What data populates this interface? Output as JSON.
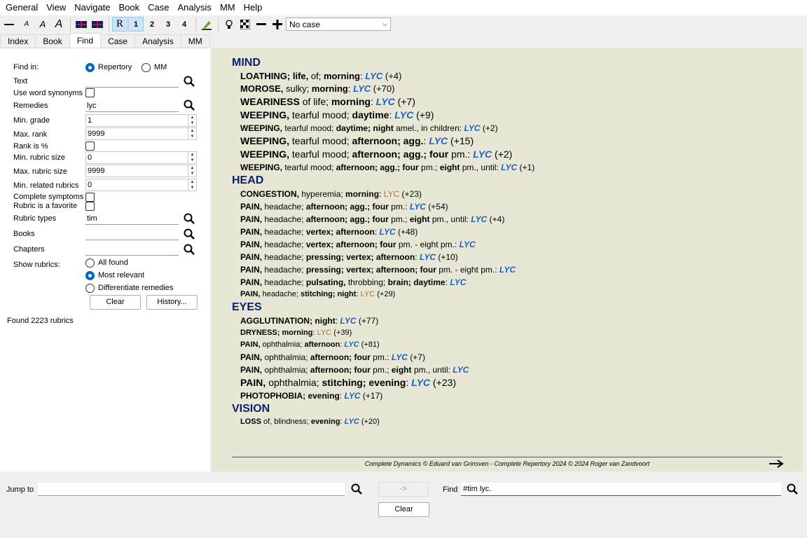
{
  "menu": [
    "General",
    "View",
    "Navigate",
    "Book",
    "Case",
    "Analysis",
    "MM",
    "Help"
  ],
  "toolbar": {
    "r": "R",
    "n1": "1",
    "n2": "2",
    "n3": "3",
    "n4": "4",
    "case_select": "No case"
  },
  "tabs": [
    "Index",
    "Book",
    "Find",
    "Case",
    "Analysis",
    "MM"
  ],
  "find": {
    "find_in_label": "Find in:",
    "repertory": "Repertory",
    "mm": "MM",
    "text_label": "Text",
    "text_value": "",
    "synonyms_label": "Use word synonyms",
    "remedies_label": "Remedies",
    "remedies_value": "lyc",
    "min_grade_label": "Min. grade",
    "min_grade": "1",
    "max_rank_label": "Max. rank",
    "max_rank": "9999",
    "rank_pct_label": "Rank is %",
    "min_rubric_label": "Min. rubric size",
    "min_rubric": "0",
    "max_rubric_label": "Max. rubric size",
    "max_rubric": "9999",
    "min_related_label": "Min. related rubrics",
    "min_related": "0",
    "complete_label": "Complete symptoms",
    "favorite_label": "Rubric is a favorite",
    "rubric_types_label": "Rubric types",
    "rubric_types": "tim",
    "books_label": "Books",
    "books": "",
    "chapters_label": "Chapters",
    "chapters": "",
    "show_label": "Show rubrics:",
    "all_found": "All found",
    "most_relevant": "Most relevant",
    "differentiate": "Differentiate remedies",
    "clear": "Clear",
    "history": "History...",
    "found": "Found 2223 rubrics"
  },
  "results": [
    {
      "chapter": "MIND",
      "rubrics": [
        {
          "sz": 13,
          "parts": [
            [
              "b",
              "LOATHING; life, "
            ],
            [
              "n",
              "of; "
            ],
            [
              "b",
              "morning"
            ],
            [
              "n",
              ": "
            ]
          ],
          "rem": "LYC",
          "cnt": "(+4)"
        },
        {
          "sz": 13,
          "parts": [
            [
              "b",
              "MOROSE, "
            ],
            [
              "n",
              "sulky; "
            ],
            [
              "b",
              "morning"
            ],
            [
              "n",
              ": "
            ]
          ],
          "rem": "LYC",
          "cnt": "(+70)"
        },
        {
          "sz": 14,
          "parts": [
            [
              "b",
              "WEARINESS "
            ],
            [
              "n",
              "of life; "
            ],
            [
              "b",
              "morning"
            ],
            [
              "n",
              ": "
            ]
          ],
          "rem": "LYC",
          "cnt": "(+7)"
        },
        {
          "sz": 14,
          "parts": [
            [
              "b",
              "WEEPING, "
            ],
            [
              "n",
              "tearful mood; "
            ],
            [
              "b",
              "daytime"
            ],
            [
              "n",
              ": "
            ]
          ],
          "rem": "LYC",
          "cnt": "(+9)"
        },
        {
          "sz": 12,
          "parts": [
            [
              "b",
              "WEEPING, "
            ],
            [
              "n",
              "tearful mood; "
            ],
            [
              "b",
              "daytime; night "
            ],
            [
              "n",
              "amel., in children: "
            ]
          ],
          "rem": "LYC",
          "cnt": "(+2)"
        },
        {
          "sz": 14,
          "parts": [
            [
              "b",
              "WEEPING, "
            ],
            [
              "n",
              "tearful mood; "
            ],
            [
              "b",
              "afternoon; agg."
            ],
            [
              "n",
              ": "
            ]
          ],
          "rem": "LYC",
          "cnt": "(+15)"
        },
        {
          "sz": 14,
          "parts": [
            [
              "b",
              "WEEPING, "
            ],
            [
              "n",
              "tearful mood; "
            ],
            [
              "b",
              "afternoon; agg.; four "
            ],
            [
              "n",
              "pm.: "
            ]
          ],
          "rem": "LYC",
          "cnt": "(+2)"
        },
        {
          "sz": 12,
          "parts": [
            [
              "b",
              "WEEPING, "
            ],
            [
              "n",
              "tearful mood; "
            ],
            [
              "b",
              "afternoon; agg.; four "
            ],
            [
              "n",
              "pm.; "
            ],
            [
              "b",
              "eight "
            ],
            [
              "n",
              "pm., until: "
            ]
          ],
          "rem": "LYC",
          "cnt": "(+1)"
        }
      ]
    },
    {
      "chapter": "HEAD",
      "rubrics": [
        {
          "sz": 12,
          "parts": [
            [
              "b",
              "CONGESTION, "
            ],
            [
              "n",
              "hyperemia; "
            ],
            [
              "b",
              "morning"
            ],
            [
              "n",
              ": "
            ]
          ],
          "rem": "LYC",
          "rem_style": "plain",
          "cnt": "(+23)"
        },
        {
          "sz": 12,
          "parts": [
            [
              "b",
              "PAIN, "
            ],
            [
              "n",
              "headache; "
            ],
            [
              "b",
              "afternoon; agg.; four "
            ],
            [
              "n",
              "pm.: "
            ]
          ],
          "rem": "LYC",
          "cnt": "(+54)"
        },
        {
          "sz": 12,
          "parts": [
            [
              "b",
              "PAIN, "
            ],
            [
              "n",
              "headache; "
            ],
            [
              "b",
              "afternoon; agg.; four "
            ],
            [
              "n",
              "pm.; "
            ],
            [
              "b",
              "eight "
            ],
            [
              "n",
              "pm., until: "
            ]
          ],
          "rem": "LYC",
          "cnt": "(+4)"
        },
        {
          "sz": 12,
          "parts": [
            [
              "b",
              "PAIN, "
            ],
            [
              "n",
              "headache; "
            ],
            [
              "b",
              "vertex; afternoon"
            ],
            [
              "n",
              ": "
            ]
          ],
          "rem": "LYC",
          "cnt": "(+48)"
        },
        {
          "sz": 12,
          "parts": [
            [
              "b",
              "PAIN, "
            ],
            [
              "n",
              "headache; "
            ],
            [
              "b",
              "vertex; afternoon; four "
            ],
            [
              "n",
              "pm. - eight pm.: "
            ]
          ],
          "rem": "LYC",
          "cnt": ""
        },
        {
          "sz": 12,
          "parts": [
            [
              "b",
              "PAIN, "
            ],
            [
              "n",
              "headache; "
            ],
            [
              "b",
              "pressing; vertex; afternoon"
            ],
            [
              "n",
              ": "
            ]
          ],
          "rem": "LYC",
          "cnt": "(+10)"
        },
        {
          "sz": 12,
          "parts": [
            [
              "b",
              "PAIN, "
            ],
            [
              "n",
              "headache; "
            ],
            [
              "b",
              "pressing; vertex; afternoon; four "
            ],
            [
              "n",
              "pm. - eight pm.: "
            ]
          ],
          "rem": "LYC",
          "cnt": ""
        },
        {
          "sz": 12,
          "parts": [
            [
              "b",
              "PAIN, "
            ],
            [
              "n",
              "headache; "
            ],
            [
              "b",
              "pulsating, "
            ],
            [
              "n",
              "throbbing; "
            ],
            [
              "b",
              "brain; daytime"
            ],
            [
              "n",
              ": "
            ]
          ],
          "rem": "LYC",
          "cnt": ""
        },
        {
          "sz": 11,
          "parts": [
            [
              "b",
              "PAIN, "
            ],
            [
              "n",
              "headache; "
            ],
            [
              "b",
              "stitching; night"
            ],
            [
              "n",
              ": "
            ]
          ],
          "rem": "LYC",
          "rem_style": "plain",
          "cnt": "(+29)"
        }
      ]
    },
    {
      "chapter": "EYES",
      "rubrics": [
        {
          "sz": 12,
          "parts": [
            [
              "b",
              "AGGLUTINATION; night"
            ],
            [
              "n",
              ": "
            ]
          ],
          "rem": "LYC",
          "cnt": "(+77)"
        },
        {
          "sz": 11,
          "parts": [
            [
              "b",
              "DRYNESS; morning"
            ],
            [
              "n",
              ": "
            ]
          ],
          "rem": "LYC",
          "rem_style": "plain",
          "cnt": "(+39)"
        },
        {
          "sz": 11,
          "parts": [
            [
              "b",
              "PAIN, "
            ],
            [
              "n",
              "ophthalmia; "
            ],
            [
              "b",
              "afternoon"
            ],
            [
              "n",
              ": "
            ]
          ],
          "rem": "LYC",
          "cnt": "(+81)"
        },
        {
          "sz": 12,
          "parts": [
            [
              "b",
              "PAIN, "
            ],
            [
              "n",
              "ophthalmia; "
            ],
            [
              "b",
              "afternoon; four "
            ],
            [
              "n",
              "pm.: "
            ]
          ],
          "rem": "LYC",
          "cnt": "(+7)"
        },
        {
          "sz": 12,
          "parts": [
            [
              "b",
              "PAIN, "
            ],
            [
              "n",
              "ophthalmia; "
            ],
            [
              "b",
              "afternoon; four "
            ],
            [
              "n",
              "pm.; "
            ],
            [
              "b",
              "eight "
            ],
            [
              "n",
              "pm., until: "
            ]
          ],
          "rem": "LYC",
          "cnt": ""
        },
        {
          "sz": 14,
          "parts": [
            [
              "b",
              "PAIN, "
            ],
            [
              "n",
              "ophthalmia; "
            ],
            [
              "b",
              "stitching; evening"
            ],
            [
              "n",
              ": "
            ]
          ],
          "rem": "LYC",
          "cnt": "(+23)"
        },
        {
          "sz": 12,
          "parts": [
            [
              "b",
              "PHOTOPHOBIA; evening"
            ],
            [
              "n",
              ": "
            ]
          ],
          "rem": "LYC",
          "cnt": "(+17)"
        }
      ]
    },
    {
      "chapter": "VISION",
      "rubrics": [
        {
          "sz": 11,
          "parts": [
            [
              "b",
              "LOSS "
            ],
            [
              "n",
              "of, blindness; "
            ],
            [
              "b",
              "evening"
            ],
            [
              "n",
              ": "
            ]
          ],
          "rem": "LYC",
          "cnt": "(+20)"
        }
      ]
    }
  ],
  "footer": "Complete Dynamics © Eduard van Grinsven   -   Complete Repertory 2024 © 2024 Roger van Zandvoort",
  "bottom": {
    "jump_label": "Jump to",
    "jump_value": "",
    "go": "->",
    "find_label": "Find",
    "find_value": "#tim lyc.",
    "clear": "Clear"
  }
}
